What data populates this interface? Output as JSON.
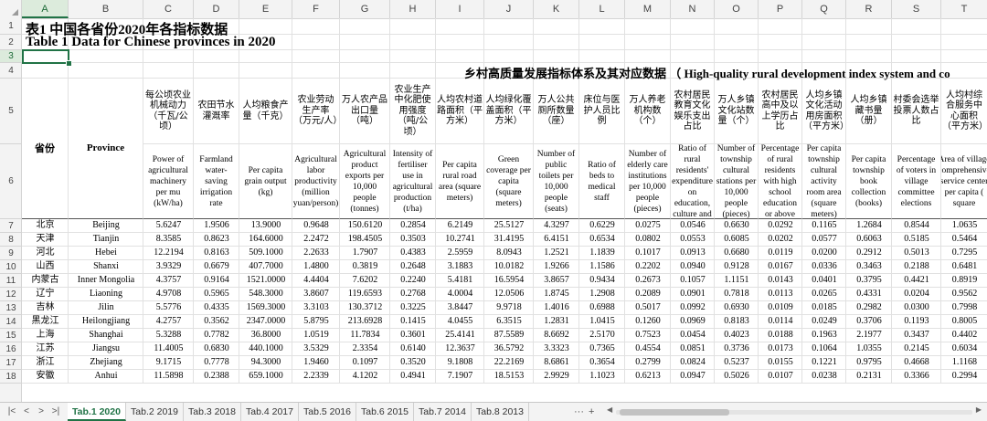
{
  "columns": [
    "A",
    "B",
    "C",
    "D",
    "E",
    "F",
    "G",
    "H",
    "I",
    "J",
    "K",
    "L",
    "M",
    "N",
    "O",
    "P",
    "Q",
    "R",
    "S",
    "T"
  ],
  "row_numbers": [
    "1",
    "2",
    "3",
    "4",
    "5",
    "6",
    "7",
    "8",
    "9",
    "10",
    "11",
    "12",
    "13",
    "14",
    "15",
    "16",
    "17",
    "18"
  ],
  "selected": {
    "column": "A",
    "row": "3"
  },
  "title_cn": "表1 中国各省份2020年各指标数据",
  "title_en": "Table 1  Data for Chinese provinces in 2020",
  "section_heading": "乡村高质量发展指标体系及其对应数据 （ High-quality rural development index system and co",
  "header_cn": [
    "省份",
    "Province",
    "每公顷农业机械动力（千瓦/公顷）",
    "农田节水灌溉率",
    "人均粮食产量（千克）",
    "农业劳动生产率（万元/人）",
    "万人农产品出口量（吨）",
    "农业生产中化肥使用强度（吨/公顷）",
    "人均农村道路面积（平方米）",
    "人均绿化覆盖面积（平方米）",
    "万人公共厕所数量（座）",
    "床位与医护人员比例",
    "万人养老机构数（个）",
    "农村居民教育文化娱乐支出占比",
    "万人乡镇文化站数量（个）",
    "农村居民高中及以上学历占比",
    "人均乡镇文化活动用房面积（平方米）",
    "人均乡镇藏书量（册）",
    "村委会选举投票人数占比",
    "人均村综合服务中心面积（平方米）"
  ],
  "header_en": [
    "",
    "",
    "Power of agricultural machinery per mu (kW/ha)",
    "Farmland water-saving irrigation rate",
    "Per capita grain output (kg)",
    "Agricultural labor productivity (million yuan/person)",
    "Agricultural product exports per 10,000 people (tonnes)",
    "Intensity of fertiliser use in agricultural production (t/ha)",
    "Per capita rural road area (square meters)",
    "Green coverage per capita (square meters)",
    "Number of public toilets per 10,000 people (seats)",
    "Ratio of beds to medical staff",
    "Number of elderly care institutions per 10,000 people (pieces)",
    "Ratio of rural residents' expenditure on education, culture and",
    "Number of township cultural stations per 10,000 people (pieces)",
    "Percentage of rural residents with high school education or above",
    "Per capita township cultural activity room area (square meters)",
    "Per capita township book collection (books)",
    "Percentage of voters in village committee elections",
    "Area of village comprehensive service center per capita ( square"
  ],
  "rows": [
    {
      "cn": "北京",
      "en": "Beijing",
      "v": [
        "5.6247",
        "1.9506",
        "13.9000",
        "0.9648",
        "150.6120",
        "0.2854",
        "6.2149",
        "25.5127",
        "4.3297",
        "0.6229",
        "0.0275",
        "0.0546",
        "0.6630",
        "0.0292",
        "0.1165",
        "1.2684",
        "0.8544",
        "1.0635"
      ]
    },
    {
      "cn": "天津",
      "en": "Tianjin",
      "v": [
        "8.3585",
        "0.8623",
        "164.6000",
        "2.2472",
        "198.4505",
        "0.3503",
        "10.2741",
        "31.4195",
        "6.4151",
        "0.6534",
        "0.0802",
        "0.0553",
        "0.6085",
        "0.0202",
        "0.0577",
        "0.6063",
        "0.5185",
        "0.5464"
      ]
    },
    {
      "cn": "河北",
      "en": "Hebei",
      "v": [
        "12.2194",
        "0.8163",
        "509.1000",
        "2.2633",
        "1.7907",
        "0.4383",
        "2.5959",
        "8.0943",
        "1.2521",
        "1.1839",
        "0.1017",
        "0.0913",
        "0.6680",
        "0.0119",
        "0.0200",
        "0.2912",
        "0.5013",
        "0.7295"
      ]
    },
    {
      "cn": "山西",
      "en": "Shanxi",
      "v": [
        "3.9329",
        "0.6679",
        "407.7000",
        "1.4800",
        "0.3819",
        "0.2648",
        "3.1883",
        "10.0182",
        "1.9266",
        "1.1586",
        "0.2202",
        "0.0940",
        "0.9128",
        "0.0167",
        "0.0336",
        "0.3463",
        "0.2188",
        "0.6481"
      ]
    },
    {
      "cn": "内蒙古",
      "en": "Inner Mongolia",
      "v": [
        "4.3757",
        "0.9164",
        "1521.0000",
        "4.4404",
        "7.6202",
        "0.2240",
        "5.4181",
        "16.5954",
        "3.8657",
        "0.9434",
        "0.2673",
        "0.1057",
        "1.1151",
        "0.0143",
        "0.0401",
        "0.3795",
        "0.4421",
        "0.8919"
      ]
    },
    {
      "cn": "辽宁",
      "en": "Liaoning",
      "v": [
        "4.9708",
        "0.5965",
        "548.3000",
        "3.8607",
        "119.6593",
        "0.2768",
        "4.0004",
        "12.0506",
        "1.8745",
        "1.2908",
        "0.2089",
        "0.0901",
        "0.7818",
        "0.0113",
        "0.0265",
        "0.4331",
        "0.0204",
        "0.9562"
      ]
    },
    {
      "cn": "吉林",
      "en": "Jilin",
      "v": [
        "5.5776",
        "0.4335",
        "1569.3000",
        "3.3103",
        "130.3712",
        "0.3225",
        "3.8447",
        "9.9718",
        "1.4016",
        "0.6988",
        "0.5017",
        "0.0992",
        "0.6930",
        "0.0109",
        "0.0185",
        "0.2982",
        "0.0300",
        "0.7998"
      ]
    },
    {
      "cn": "黑龙江",
      "en": "Heilongjiang",
      "v": [
        "4.2757",
        "0.3562",
        "2347.0000",
        "5.8795",
        "213.6928",
        "0.1415",
        "4.0455",
        "6.3515",
        "1.2831",
        "1.0415",
        "0.1260",
        "0.0969",
        "0.8183",
        "0.0114",
        "0.0249",
        "0.3706",
        "0.1193",
        "0.8005"
      ]
    },
    {
      "cn": "上海",
      "en": "Shanghai",
      "v": [
        "5.3288",
        "0.7782",
        "36.8000",
        "1.0519",
        "11.7834",
        "0.3601",
        "25.4141",
        "87.5589",
        "8.6692",
        "2.5170",
        "0.7523",
        "0.0454",
        "0.4023",
        "0.0188",
        "0.1963",
        "2.1977",
        "0.3437",
        "0.4402"
      ]
    },
    {
      "cn": "江苏",
      "en": "Jiangsu",
      "v": [
        "11.4005",
        "0.6830",
        "440.1000",
        "3.5329",
        "2.3354",
        "0.6140",
        "12.3637",
        "36.5792",
        "3.3323",
        "0.7365",
        "0.4554",
        "0.0851",
        "0.3736",
        "0.0173",
        "0.1064",
        "1.0355",
        "0.2145",
        "0.6034"
      ]
    },
    {
      "cn": "浙江",
      "en": "Zhejiang",
      "v": [
        "9.1715",
        "0.7778",
        "94.3000",
        "1.9460",
        "0.1097",
        "0.3520",
        "9.1808",
        "22.2169",
        "8.6861",
        "0.3654",
        "0.2799",
        "0.0824",
        "0.5237",
        "0.0155",
        "0.1221",
        "0.9795",
        "0.4668",
        "1.1168"
      ]
    },
    {
      "cn": "安徽",
      "en": "Anhui",
      "v": [
        "11.5898",
        "0.2388",
        "659.1000",
        "2.2339",
        "4.1202",
        "0.4941",
        "7.1907",
        "18.5153",
        "2.9929",
        "1.1023",
        "0.6213",
        "0.0947",
        "0.5026",
        "0.0107",
        "0.0238",
        "0.2131",
        "0.3366",
        "0.2994"
      ]
    }
  ],
  "tabs": [
    "Tab.1 2020",
    "Tab.2 2019",
    "Tab.3 2018",
    "Tab.4 2017",
    "Tab.5 2016",
    "Tab.6 2015",
    "Tab.7 2014",
    "Tab.8 2013"
  ],
  "active_tab": "Tab.1 2020",
  "tab_more": "···",
  "tab_add": "+",
  "nav": {
    "first": "|<",
    "prev": "<",
    "next": ">",
    "last": ">|"
  }
}
